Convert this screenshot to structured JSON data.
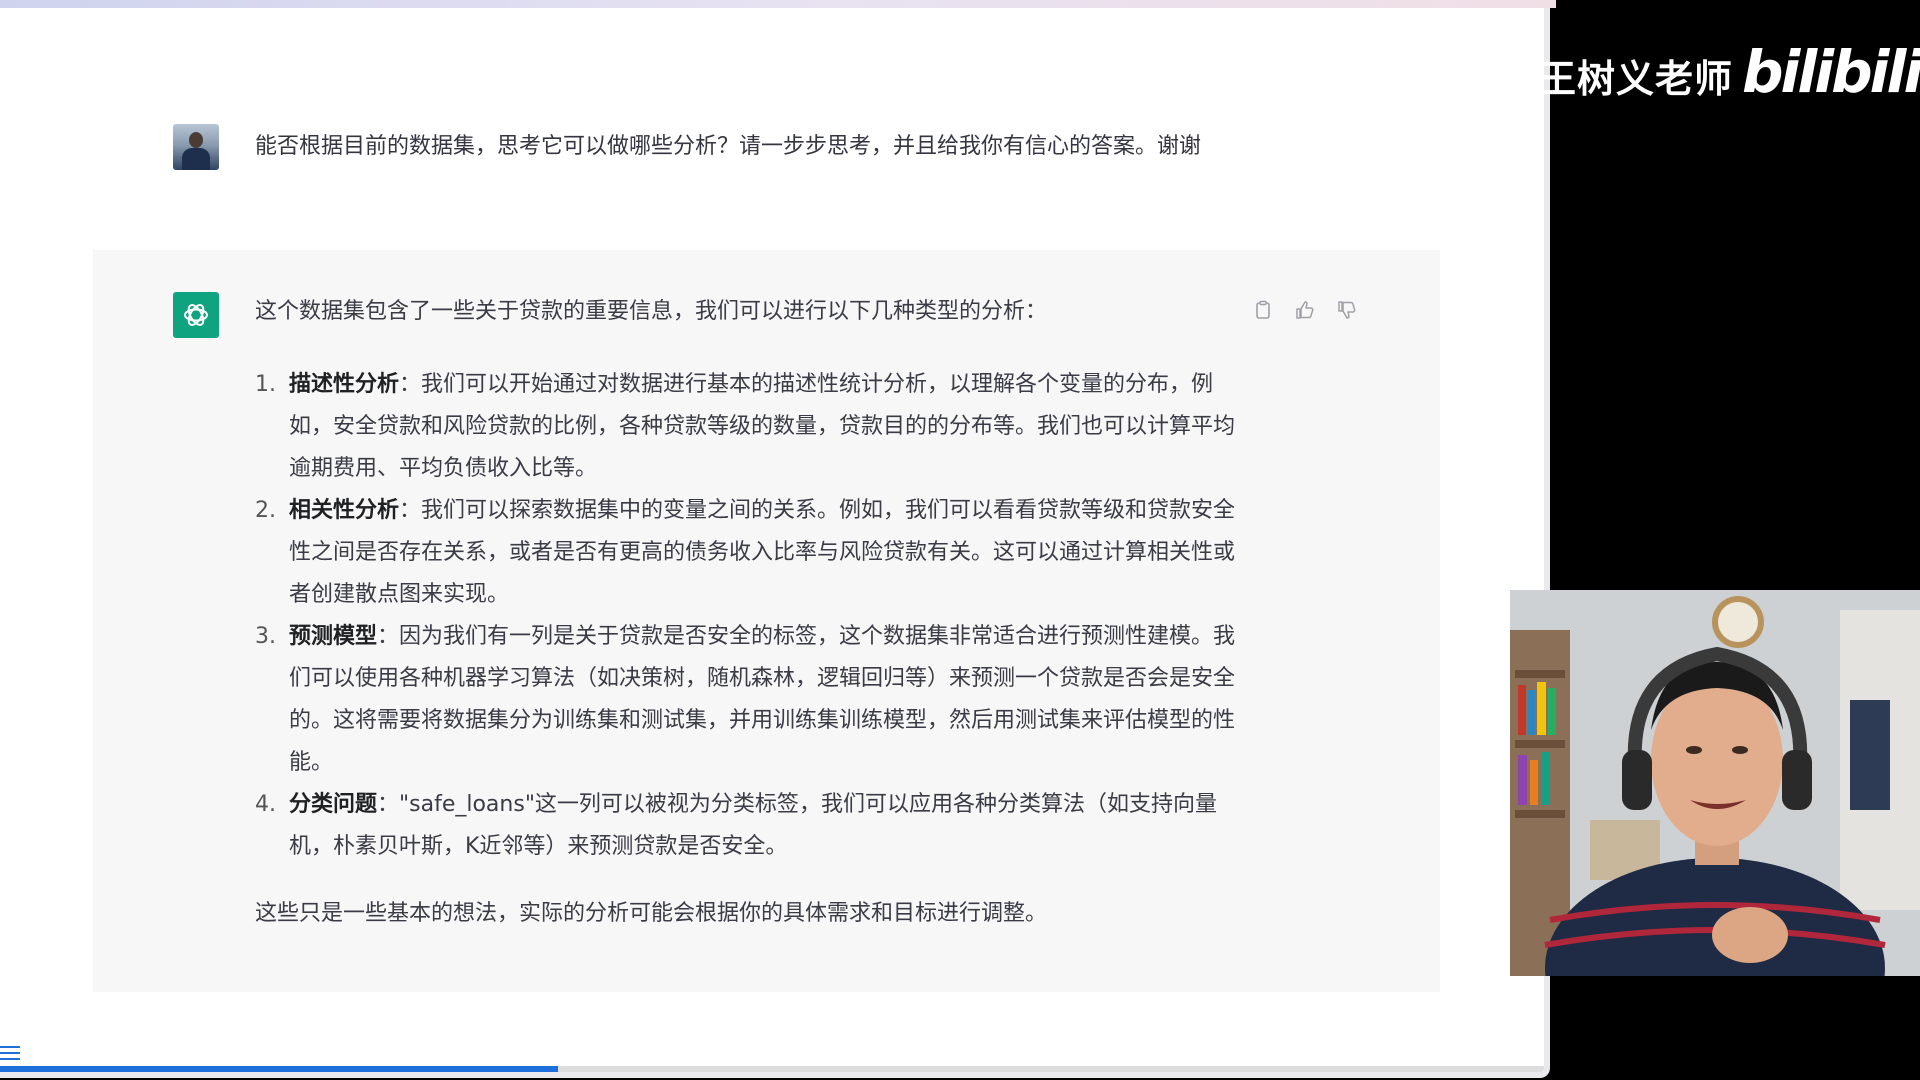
{
  "overlay": {
    "channel_name": "王树义老师",
    "site_logo": "bilibili"
  },
  "user_message": {
    "text": "能否根据目前的数据集，思考它可以做哪些分析？请一步步思考，并且给我你有信心的答案。谢谢"
  },
  "assistant_message": {
    "intro": "这个数据集包含了一些关于贷款的重要信息，我们可以进行以下几种类型的分析：",
    "items": [
      {
        "number": "1.",
        "title": "描述性分析",
        "text": "：我们可以开始通过对数据进行基本的描述性统计分析，以理解各个变量的分布，例如，安全贷款和风险贷款的比例，各种贷款等级的数量，贷款目的的分布等。我们也可以计算平均逾期费用、平均负债收入比等。"
      },
      {
        "number": "2.",
        "title": "相关性分析",
        "text": "：我们可以探索数据集中的变量之间的关系。例如，我们可以看看贷款等级和贷款安全性之间是否存在关系，或者是否有更高的债务收入比率与风险贷款有关。这可以通过计算相关性或者创建散点图来实现。"
      },
      {
        "number": "3.",
        "title": "预测模型",
        "text": "：因为我们有一列是关于贷款是否安全的标签，这个数据集非常适合进行预测性建模。我们可以使用各种机器学习算法（如决策树，随机森林，逻辑回归等）来预测一个贷款是否会是安全的。这将需要将数据集分为训练集和测试集，并用训练集训练模型，然后用测试集来评估模型的性能。"
      },
      {
        "number": "4.",
        "title": "分类问题",
        "text": "：\"safe_loans\"这一列可以被视为分类标签，我们可以应用各种分类算法（如支持向量机，朴素贝叶斯，K近邻等）来预测贷款是否安全。"
      }
    ],
    "closing": "这些只是一些基本的想法，实际的分析可能会根据你的具体需求和目标进行调整。",
    "actions": [
      "copy-icon",
      "thumbs-up-icon",
      "thumbs-down-icon"
    ]
  },
  "video_progress": 0.36,
  "colors": {
    "assistant_avatar": "#10a37f",
    "assistant_bg": "#f7f7f8",
    "progress": "#1e6fd9"
  }
}
